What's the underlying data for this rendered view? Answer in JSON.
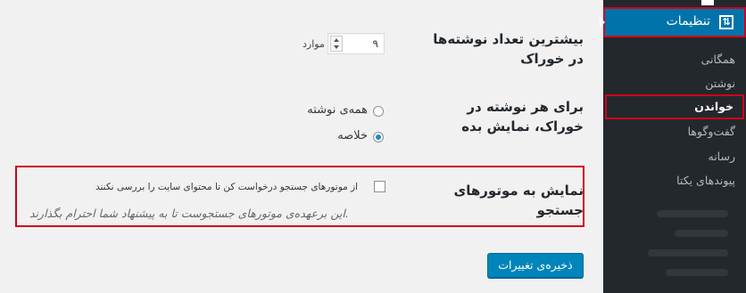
{
  "sidebar": {
    "heading": "تنظیمات",
    "icon": "settings-sliders-icon",
    "items": [
      {
        "label": "همگانی",
        "active": false
      },
      {
        "label": "نوشتن",
        "active": false
      },
      {
        "label": "خواندن",
        "active": true
      },
      {
        "label": "گفت‌وگوها",
        "active": false
      },
      {
        "label": "رسانه",
        "active": false
      },
      {
        "label": "پیوندهای یکتا",
        "active": false
      }
    ]
  },
  "feed_count": {
    "label": "بیشترین تعداد نوشته‌ها در خوراک",
    "value": "۹",
    "unit": "موارد"
  },
  "feed_display": {
    "label": "برای هر نوشته در خوراک، نمایش بده",
    "options": [
      {
        "label": "همه‌ی نوشته",
        "checked": false
      },
      {
        "label": "خلاصه",
        "checked": true
      }
    ]
  },
  "search_engines": {
    "label": "نمایش به موتورهای جستجو",
    "checkbox_label": "از موتورهای جستجو درخواست کن تا محتوای سایت را بررسی نکنند",
    "checked": false,
    "description": "این برعهده‌ی موتورهای جستجوست تا به پیشنهاد شما احترام بگذارند."
  },
  "save_button": "ذخیره‌ی تغییرات",
  "colors": {
    "accent": "#0073aa",
    "highlight": "#d0021b",
    "sidebar_bg": "#23282d",
    "page_bg": "#f1f1f1"
  }
}
